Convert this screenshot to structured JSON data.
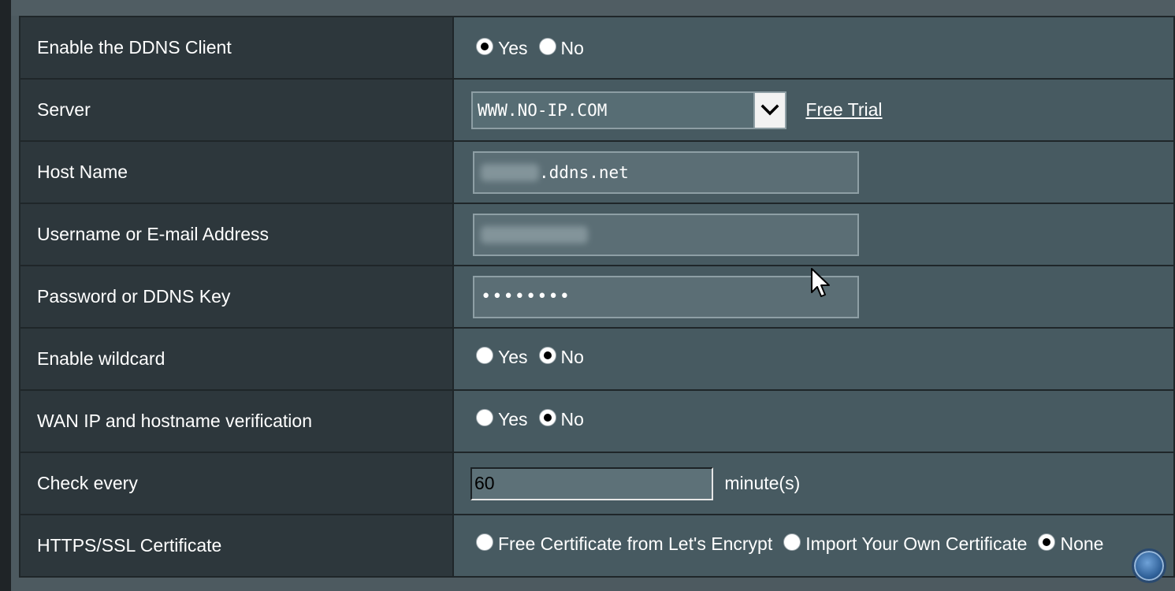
{
  "rows": {
    "ddns_client": {
      "label": "Enable the DDNS Client",
      "options": [
        "Yes",
        "No"
      ],
      "selected": "Yes"
    },
    "server": {
      "label": "Server",
      "value": "WWW.NO-IP.COM",
      "link": "Free Trial"
    },
    "host_name": {
      "label": "Host Name",
      "suffix": ".ddns.net"
    },
    "username": {
      "label": "Username or E-mail Address"
    },
    "password": {
      "label": "Password or DDNS Key",
      "masked": "••••••••"
    },
    "wildcard": {
      "label": "Enable wildcard",
      "options": [
        "Yes",
        "No"
      ],
      "selected": "No"
    },
    "wan_verify": {
      "label": "WAN IP and hostname verification",
      "options": [
        "Yes",
        "No"
      ],
      "selected": "No"
    },
    "check_every": {
      "label": "Check every",
      "value": "60",
      "unit": "minute(s)"
    },
    "https_cert": {
      "label": "HTTPS/SSL Certificate",
      "options": [
        "Free Certificate from Let's Encrypt",
        "Import Your Own Certificate",
        "None"
      ],
      "selected": "None"
    }
  },
  "icons": {
    "dropdown": "chevron-down-icon",
    "pointer": "mouse-pointer-icon",
    "floating": "floating-action-button"
  },
  "colors": {
    "label_bg": "#2d373c",
    "value_bg": "#475a61",
    "border": "#1f2629"
  }
}
